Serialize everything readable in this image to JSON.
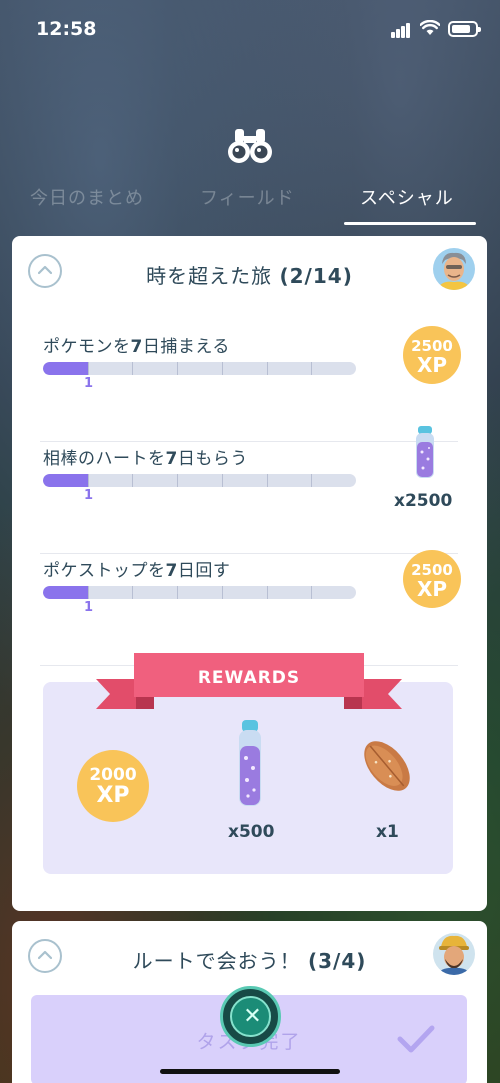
{
  "status_bar": {
    "time": "12:58"
  },
  "tabs": [
    {
      "label": "今日のまとめ",
      "active": false
    },
    {
      "label": "フィールド",
      "active": false
    },
    {
      "label": "スペシャル",
      "active": true
    }
  ],
  "research": {
    "title": "時を超えた旅",
    "progress": "(2/14)",
    "tasks": [
      {
        "label_prefix": "ポケモンを",
        "label_number": "7",
        "label_suffix": "日捕まえる",
        "progress": 1,
        "goal": 7,
        "progress_text": "1",
        "reward": {
          "type": "xp",
          "amount": "2500",
          "unit": "XP"
        }
      },
      {
        "label_prefix": "相棒のハートを",
        "label_number": "7",
        "label_suffix": "日もらう",
        "progress": 1,
        "goal": 7,
        "progress_text": "1",
        "reward": {
          "type": "stardust-potion-icon",
          "quantity": "x2500"
        }
      },
      {
        "label_prefix": "ポケストップを",
        "label_number": "7",
        "label_suffix": "日回す",
        "progress": 1,
        "goal": 7,
        "progress_text": "1",
        "reward": {
          "type": "xp",
          "amount": "2500",
          "unit": "XP"
        }
      }
    ],
    "rewards": {
      "banner": "REWARDS",
      "items": [
        {
          "type": "xp",
          "amount": "2000",
          "unit": "XP"
        },
        {
          "type": "stardust-potion-icon",
          "quantity": "x500"
        },
        {
          "type": "bread-icon",
          "quantity": "x1"
        }
      ]
    }
  },
  "route_research": {
    "title": "ルートで会おう！",
    "progress": "(3/4)",
    "complete_label": "タスク完了"
  },
  "colors": {
    "accent_purple": "#8a73ec",
    "xp_gold": "#f9c459",
    "ribbon_pink": "#f0607e",
    "rewards_bg": "#e8e6fa",
    "fab_teal": "#1b8c77"
  }
}
